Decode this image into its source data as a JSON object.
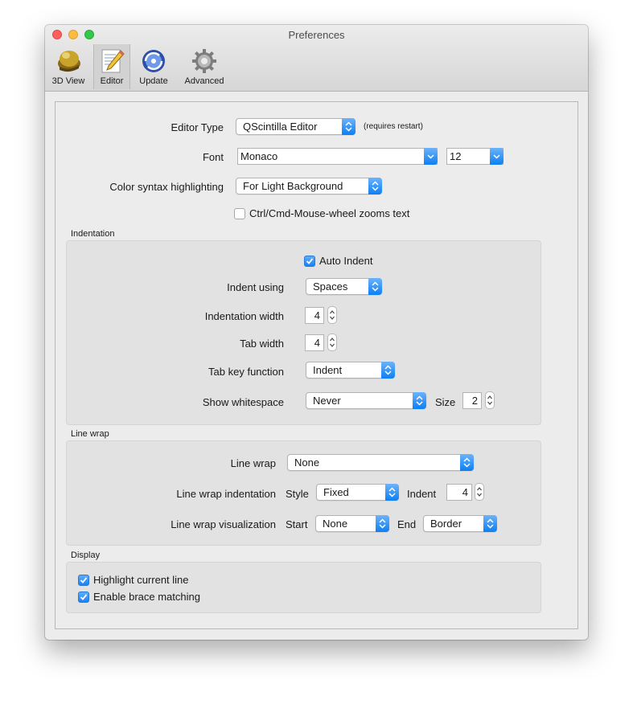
{
  "window": {
    "title": "Preferences"
  },
  "toolbar": {
    "items": [
      {
        "label": "3D View",
        "icon": "3d-view-icon"
      },
      {
        "label": "Editor",
        "icon": "editor-icon",
        "active": true
      },
      {
        "label": "Update",
        "icon": "update-icon"
      },
      {
        "label": "Advanced",
        "icon": "gear-icon"
      }
    ]
  },
  "editor": {
    "editor_type": {
      "label": "Editor Type",
      "value": "QScintilla Editor",
      "note": "(requires restart)"
    },
    "font": {
      "label": "Font",
      "value": "Monaco",
      "size": "12"
    },
    "color_syntax": {
      "label": "Color syntax highlighting",
      "value": "For Light Background"
    },
    "wheel_zoom": {
      "label": "Ctrl/Cmd-Mouse-wheel zooms text",
      "checked": false
    }
  },
  "indentation": {
    "title": "Indentation",
    "auto_indent": {
      "label": "Auto Indent",
      "checked": true
    },
    "indent_using": {
      "label": "Indent using",
      "value": "Spaces"
    },
    "indentation_width": {
      "label": "Indentation width",
      "value": "4"
    },
    "tab_width": {
      "label": "Tab width",
      "value": "4"
    },
    "tab_key_function": {
      "label": "Tab key function",
      "value": "Indent"
    },
    "show_whitespace": {
      "label": "Show whitespace",
      "value": "Never",
      "size_label": "Size",
      "size_value": "2"
    }
  },
  "line_wrap": {
    "title": "Line wrap",
    "line_wrap": {
      "label": "Line wrap",
      "value": "None"
    },
    "indentation": {
      "label": "Line wrap indentation",
      "style_label": "Style",
      "style_value": "Fixed",
      "indent_label": "Indent",
      "indent_value": "4"
    },
    "visualization": {
      "label": "Line wrap visualization",
      "start_label": "Start",
      "start_value": "None",
      "end_label": "End",
      "end_value": "Border"
    }
  },
  "display": {
    "title": "Display",
    "highlight_current_line": {
      "label": "Highlight current line",
      "checked": true
    },
    "brace_matching": {
      "label": "Enable brace matching",
      "checked": true
    }
  },
  "colors": {
    "accent": "#1a82f4",
    "close": "#fc605c",
    "minimize": "#fdbc40",
    "maximize": "#34c84a"
  }
}
